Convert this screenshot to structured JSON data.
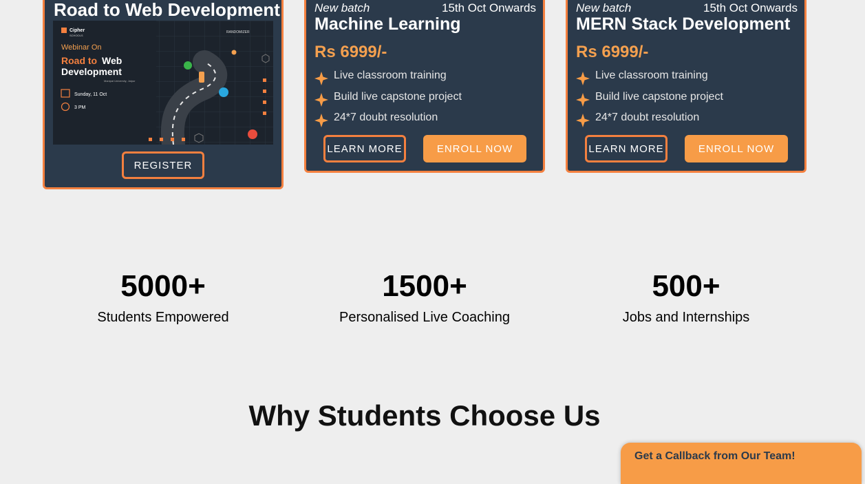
{
  "webinar_card": {
    "title": "Road to Web Development",
    "register_label": "REGISTER",
    "banner": {
      "brand_line1": "Cipher",
      "brand_line2": "SCHOOLS",
      "partner": "RANDOMIZER",
      "webinar_on": "Webinar On",
      "title_line1_orange": "Road to",
      "title_line1_white": "Web",
      "title_line2": "Development",
      "venue": "Manipal University, Jaipur",
      "date": "Sunday, 11 Oct",
      "time": "3 PM"
    }
  },
  "courses": [
    {
      "batch_label": "New batch",
      "batch_date": "15th Oct Onwards",
      "title": "Machine Learning",
      "price": "Rs 6999/-",
      "features": [
        "Live classroom training",
        "Build live capstone project",
        "24*7 doubt resolution"
      ],
      "learn_more_label": "LEARN MORE",
      "enroll_label": "ENROLL NOW"
    },
    {
      "batch_label": "New batch",
      "batch_date": "15th Oct Onwards",
      "title": "MERN Stack Development",
      "price": "Rs 6999/-",
      "features": [
        "Live classroom training",
        "Build live capstone project",
        "24*7 doubt resolution"
      ],
      "learn_more_label": "LEARN MORE",
      "enroll_label": "ENROLL NOW"
    }
  ],
  "stats": [
    {
      "number": "5000+",
      "label": "Students Empowered"
    },
    {
      "number": "1500+",
      "label": "Personalised Live Coaching"
    },
    {
      "number": "500+",
      "label": "Jobs and Internships"
    }
  ],
  "section_title": "Why Students Choose Us",
  "callback_label": "Get a Callback from Our Team!",
  "colors": {
    "card_bg": "#2b3a4b",
    "accent_border": "#f4803f",
    "accent_fill": "#f79c47",
    "price": "#f4a04f",
    "page_bg": "#eeeeee"
  },
  "icons": {
    "feature_bullet": "four-point-star-icon"
  }
}
